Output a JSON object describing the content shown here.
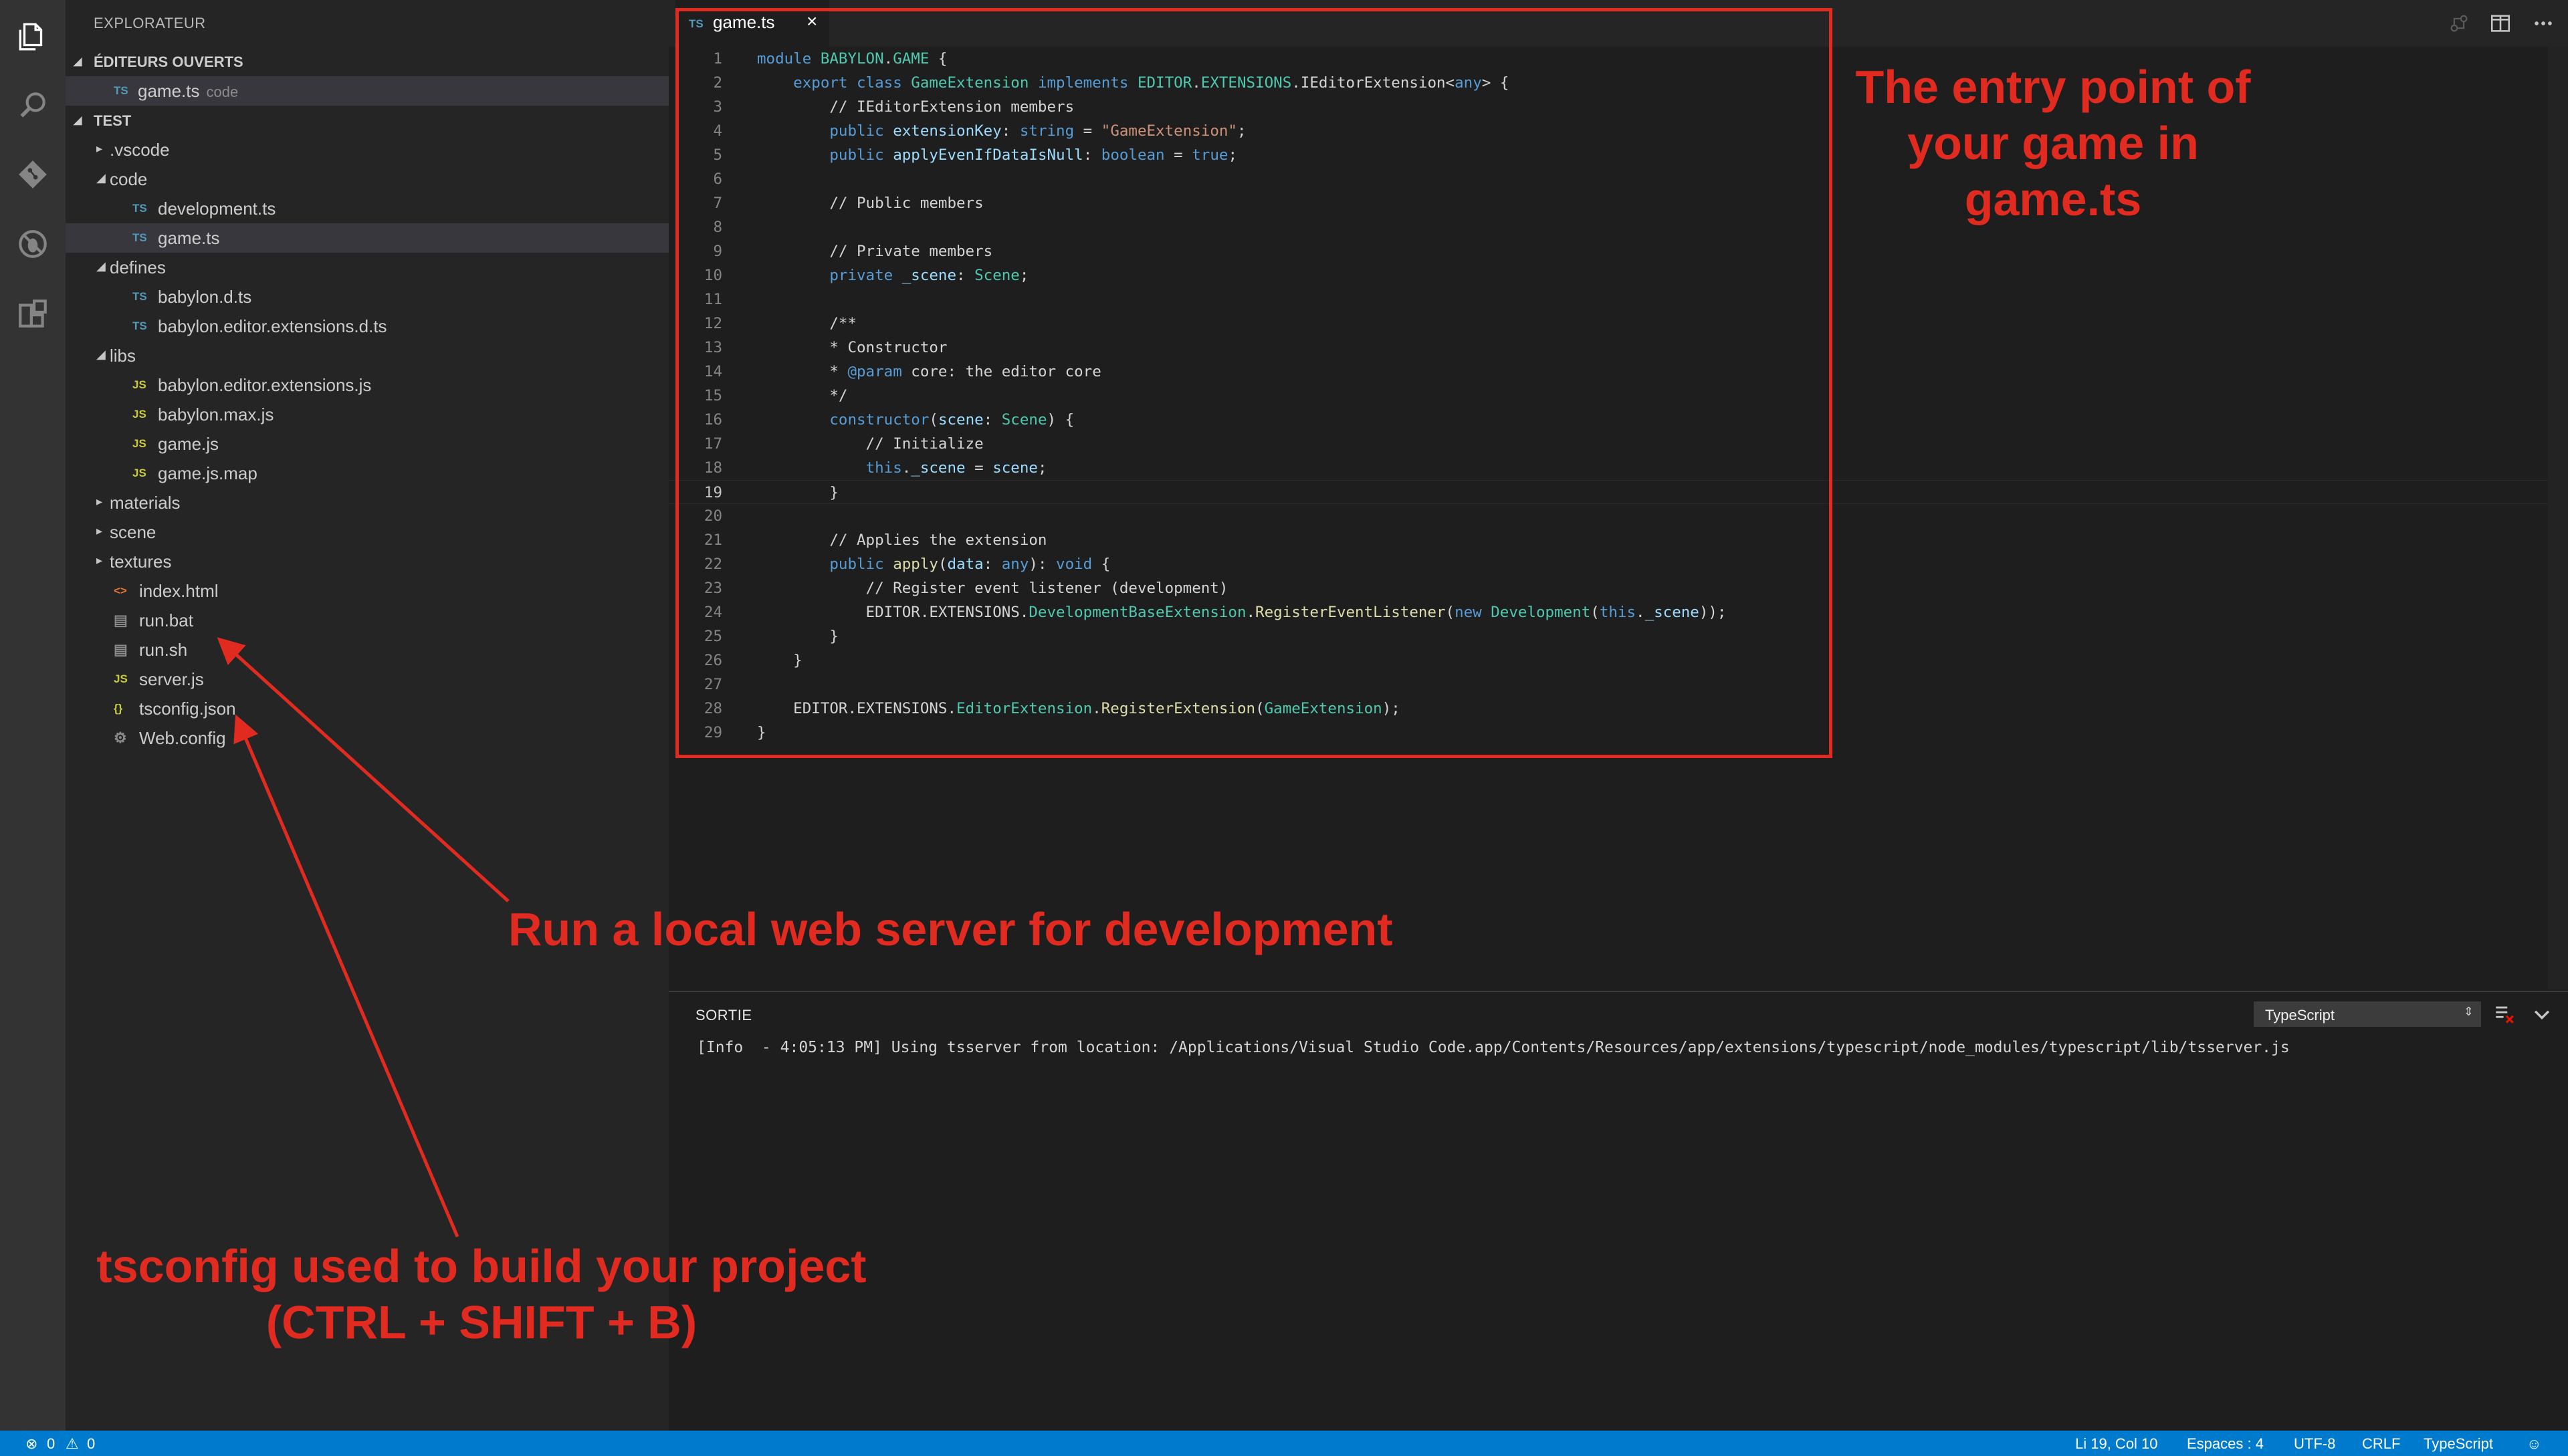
{
  "sidebar": {
    "title": "EXPLORATEUR",
    "open_editors": {
      "label": "ÉDITEURS OUVERTS",
      "items": [
        {
          "icon": "TS",
          "name": "game.ts",
          "desc": "code"
        }
      ]
    },
    "workspace": {
      "label": "TEST",
      "items": [
        {
          "name": ".vscode",
          "type": "folder",
          "expanded": false
        },
        {
          "name": "code",
          "type": "folder",
          "expanded": true
        },
        {
          "name": "development.ts",
          "icon": "TS"
        },
        {
          "name": "game.ts",
          "icon": "TS",
          "selected": true
        },
        {
          "name": "defines",
          "type": "folder",
          "expanded": true
        },
        {
          "name": "babylon.d.ts",
          "icon": "TS"
        },
        {
          "name": "babylon.editor.extensions.d.ts",
          "icon": "TS"
        },
        {
          "name": "libs",
          "type": "folder",
          "expanded": true
        },
        {
          "name": "babylon.editor.extensions.js",
          "icon": "JS"
        },
        {
          "name": "babylon.max.js",
          "icon": "JS"
        },
        {
          "name": "game.js",
          "icon": "JS"
        },
        {
          "name": "game.js.map",
          "icon": "JS"
        },
        {
          "name": "materials",
          "type": "folder",
          "expanded": false
        },
        {
          "name": "scene",
          "type": "folder",
          "expanded": false
        },
        {
          "name": "textures",
          "type": "folder",
          "expanded": false
        },
        {
          "name": "index.html",
          "icon": "<>"
        },
        {
          "name": "run.bat",
          "icon": "file"
        },
        {
          "name": "run.sh",
          "icon": "file"
        },
        {
          "name": "server.js",
          "icon": "JS"
        },
        {
          "name": "tsconfig.json",
          "icon": "{}"
        },
        {
          "name": "Web.config",
          "icon": "gear"
        }
      ]
    }
  },
  "editor": {
    "tab": {
      "icon": "TS",
      "name": "game.ts",
      "close": "×"
    },
    "line_numbers": [
      "1",
      "2",
      "3",
      "4",
      "5",
      "6",
      "7",
      "8",
      "9",
      "10",
      "11",
      "12",
      "13",
      "14",
      "15",
      "16",
      "17",
      "18",
      "19",
      "20",
      "21",
      "22",
      "23",
      "24",
      "25",
      "26",
      "27",
      "28",
      "29"
    ],
    "code": {
      "l1a": "module ",
      "l1b": "BABYLON",
      "l1c": ".",
      "l1d": "GAME",
      "l1e": " {",
      "l2a": "    export class ",
      "l2b": "GameExtension",
      "l2c": " implements ",
      "l2d": "EDITOR",
      "l2e": ".",
      "l2f": "EXTENSIONS",
      "l2g": ".IEditorExtension<",
      "l2h": "any",
      "l2i": "> {",
      "l3": "        // IEditorExtension members",
      "l4a": "        public ",
      "l4b": "extensionKey",
      "l4c": ": ",
      "l4d": "string",
      "l4e": " = ",
      "l4f": "\"GameExtension\"",
      "l4g": ";",
      "l5a": "        public ",
      "l5b": "applyEvenIfDataIsNull",
      "l5c": ": ",
      "l5d": "boolean",
      "l5e": " = ",
      "l5f": "true",
      "l5g": ";",
      "l7": "        // Public members",
      "l9": "        // Private members",
      "l10a": "        private ",
      "l10b": "_scene",
      "l10c": ": ",
      "l10d": "Scene",
      "l10e": ";",
      "l12": "        /**",
      "l13": "        * Constructor",
      "l14a": "        * ",
      "l14b": "@param",
      "l14c": " core: the editor core",
      "l15": "        */",
      "l16a": "        constructor",
      "l16b": "(",
      "l16c": "scene",
      "l16d": ": ",
      "l16e": "Scene",
      "l16f": ") {",
      "l17": "            // Initialize",
      "l18a": "            this",
      "l18b": ".",
      "l18c": "_scene",
      "l18d": " = ",
      "l18e": "scene",
      "l18f": ";",
      "l19": "        }",
      "l21": "        // Applies the extension",
      "l22a": "        public ",
      "l22b": "apply",
      "l22c": "(",
      "l22d": "data",
      "l22e": ": ",
      "l22f": "any",
      "l22g": "): ",
      "l22h": "void",
      "l22i": " {",
      "l23": "            // Register event listener (development)",
      "l24a": "            EDITOR.EXTENSIONS.",
      "l24b": "DevelopmentBaseExtension",
      "l24c": ".",
      "l24d": "RegisterEventListener",
      "l24e": "(",
      "l24f": "new ",
      "l24g": "Development",
      "l24h": "(",
      "l24i": "this",
      "l24j": ".",
      "l24k": "_scene",
      "l24l": "));",
      "l25": "        }",
      "l26": "    }",
      "l28a": "    EDITOR.EXTENSIONS.",
      "l28b": "EditorExtension",
      "l28c": ".",
      "l28d": "RegisterExtension",
      "l28e": "(",
      "l28f": "GameExtension",
      "l28g": ");",
      "l29": "}"
    }
  },
  "panel": {
    "title": "SORTIE",
    "select_value": "TypeScript",
    "output": "[Info  - 4:05:13 PM] Using tsserver from location: /Applications/Visual Studio Code.app/Contents/Resources/app/extensions/typescript/node_modules/typescript/lib/tsserver.js"
  },
  "statusbar": {
    "errors": "0",
    "warnings": "0",
    "position": "Li 19, Col 10",
    "spaces": "Espaces : 4",
    "encoding": "UTF-8",
    "eol": "CRLF",
    "language": "TypeScript"
  },
  "annotations": {
    "entry": [
      "The entry point of",
      "your game in",
      "game.ts"
    ],
    "server": "Run a local web server for development",
    "tsconfig": [
      "tsconfig used to build your project",
      "(CTRL + SHIFT + B)"
    ]
  },
  "colors": {
    "annotation": "#e12b20",
    "statusbar": "#007acc",
    "activitybar": "#333333",
    "sidebar": "#252526",
    "editor": "#1e1e1e"
  },
  "icons": {
    "activity": [
      "files-icon",
      "search-icon",
      "git-icon",
      "debug-icon",
      "extensions-icon"
    ]
  }
}
